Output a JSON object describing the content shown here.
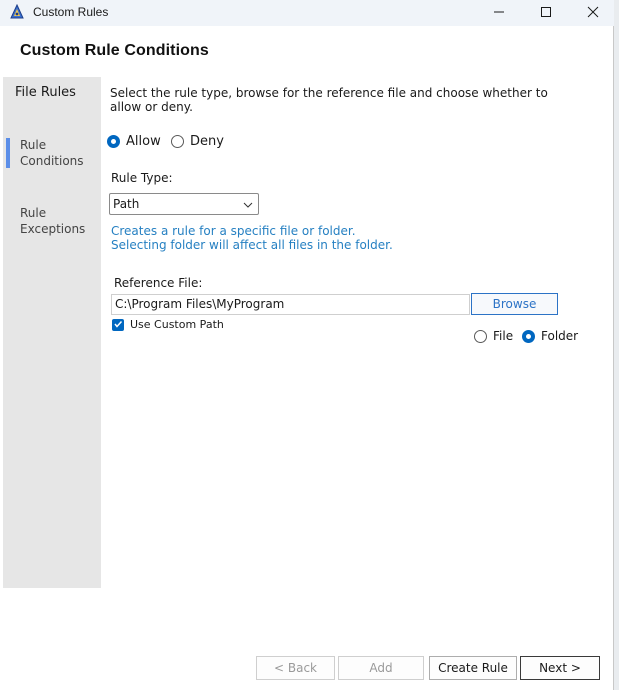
{
  "window": {
    "title": "Custom Rules"
  },
  "header": {
    "title": "Custom Rule Conditions"
  },
  "sidebar": {
    "items": [
      {
        "label": "File Rules"
      },
      {
        "label": "Rule Conditions"
      },
      {
        "label": "Rule Exceptions"
      }
    ],
    "active_index": 1
  },
  "main": {
    "description": "Select the rule type, browse for the reference file and choose whether to allow or deny.",
    "action": {
      "allow_label": "Allow",
      "deny_label": "Deny",
      "selected": "Allow"
    },
    "rule_type": {
      "label": "Rule Type:",
      "value": "Path"
    },
    "hint_line1": "Creates a rule for a specific file or folder.",
    "hint_line2": "Selecting folder will affect all files in the folder.",
    "reference": {
      "label": "Reference File:",
      "value": "C:\\Program Files\\MyProgram",
      "browse_label": "Browse"
    },
    "custom_path": {
      "label": "Use Custom Path",
      "checked": true
    },
    "target": {
      "file_label": "File",
      "folder_label": "Folder",
      "selected": "Folder"
    }
  },
  "footer": {
    "back_label": "< Back",
    "add_label": "Add",
    "create_label": "Create Rule",
    "next_label": "Next >"
  },
  "colors": {
    "accent": "#0067c0",
    "hint": "#2680c2",
    "sidebar_bg": "#e6e6e6",
    "sidebar_indicator": "#5b8ee8"
  },
  "icons": {
    "app": "app-icon",
    "minimize": "minimize-icon",
    "maximize": "maximize-icon",
    "close": "close-icon",
    "dropdown": "chevron-down-icon",
    "checkbox": "checkmark-icon"
  }
}
